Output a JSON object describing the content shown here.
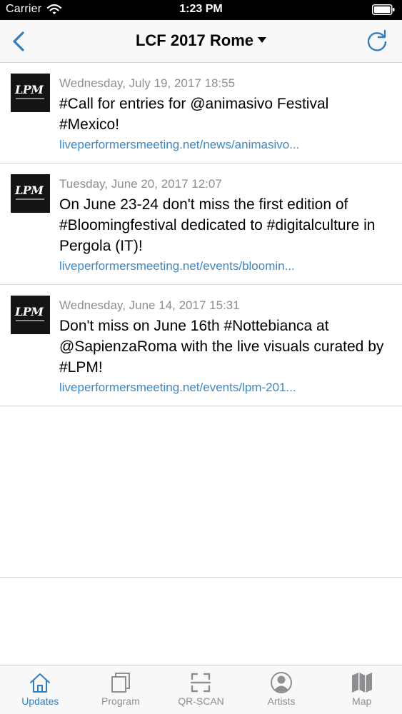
{
  "status_bar": {
    "carrier": "Carrier",
    "time": "1:23 PM",
    "icons": [
      "wifi-icon",
      "battery-icon"
    ]
  },
  "nav": {
    "title": "LCF 2017 Rome",
    "icons": [
      "back-chevron-icon",
      "dropdown-triangle-icon",
      "refresh-icon"
    ]
  },
  "colors": {
    "accent": "#2f7fc1",
    "link": "#3a87c9",
    "date_gray": "#8e8e93",
    "tab_inactive": "#8e8e93"
  },
  "feed": {
    "items": [
      {
        "avatar": "LPM",
        "date": "Wednesday, July 19, 2017 18:55",
        "text": "#Call for entries for @animasivo Festival #Mexico!",
        "link": "liveperformersmeeting.net/news/animasivo..."
      },
      {
        "avatar": "LPM",
        "date": "Tuesday, June 20, 2017 12:07",
        "text": "On June 23-24 don't miss the first edition of #Bloomingfestival dedicated to #digitalculture in Pergola (IT)!",
        "link": "liveperformersmeeting.net/events/bloomin..."
      },
      {
        "avatar": "LPM",
        "date": "Wednesday, June 14, 2017 15:31",
        "text": "Don't miss on June 16th #Nottebianca at @SapienzaRoma with the live visuals curated by #LPM!",
        "link": "liveperformersmeeting.net/events/lpm-201..."
      }
    ]
  },
  "tabs": [
    {
      "label": "Updates",
      "icon": "home-icon",
      "active": true
    },
    {
      "label": "Program",
      "icon": "program-icon",
      "active": false
    },
    {
      "label": "QR-SCAN",
      "icon": "qr-scan-icon",
      "active": false
    },
    {
      "label": "Artists",
      "icon": "artist-icon",
      "active": false
    },
    {
      "label": "Map",
      "icon": "map-icon",
      "active": false
    }
  ]
}
